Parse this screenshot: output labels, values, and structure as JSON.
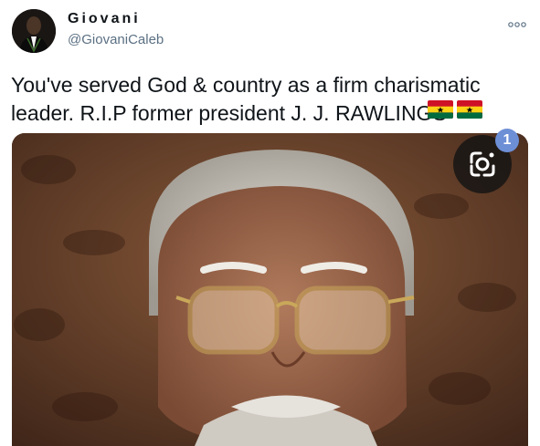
{
  "author": {
    "display_name": "Giovani",
    "handle": "@GiovaniCaleb"
  },
  "tweet": {
    "text": "You've served God & country as a firm charismatic\nleader. R.I.P former president J. J. RAWLINGS",
    "emoji": [
      "ghana-flag",
      "ghana-flag"
    ]
  },
  "media": {
    "lens_badge_count": "1",
    "lens_icon": "google-lens-icon"
  },
  "colors": {
    "handle": "#5b7083",
    "text": "#0f1419",
    "badge": "#6d8fd6"
  }
}
